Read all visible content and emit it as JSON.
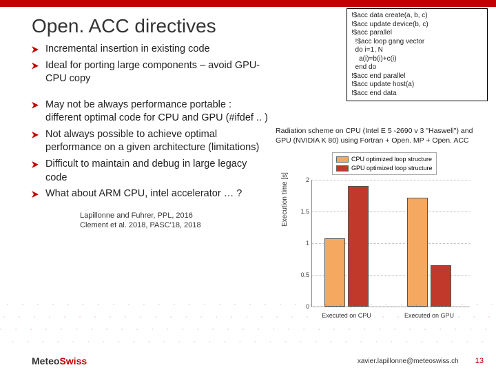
{
  "title": "Open. ACC directives",
  "pros": [
    "Incremental insertion in existing code",
    "Ideal for porting large components – avoid GPU-CPU copy"
  ],
  "cons": [
    "May not be always performance portable : different optimal code for CPU and GPU (#ifdef .. )",
    "Not always possible to achieve optimal performance on a given architecture (limitations)",
    "Difficult to maintain and debug in large legacy code",
    "What about ARM CPU, intel accelerator … ?"
  ],
  "refs": [
    "Lapillonne and Fuhrer, PPL, 2016",
    "Clement et al. 2018, PASC'18, 2018"
  ],
  "code_lines": "!$acc data create(a, b, c)\n!$acc update device(b, c)\n!$acc parallel\n  !$acc loop gang vector\n  do i=1, N\n    a(i)=b(i)+c(i)\n  end do\n!$acc end parallel\n!$acc update host(a)\n!$acc end data",
  "chart_caption": "Radiation scheme on CPU (Intel E 5 -2690 v 3 \"Haswell\") and GPU (NVIDIA K 80) using Fortran + Open. MP + Open. ACC",
  "chart_data": {
    "type": "bar",
    "title": "",
    "xlabel": "",
    "ylabel": "Execution time [s]",
    "ylim": [
      0,
      2.0
    ],
    "yticks": [
      0,
      0.5,
      1.0,
      1.5,
      2.0
    ],
    "categories": [
      "Executed on CPU",
      "Executed on GPU"
    ],
    "series": [
      {
        "name": "CPU optimized loop structure",
        "values": [
          1.08,
          1.72
        ]
      },
      {
        "name": "GPU optimized loop structure",
        "values": [
          1.9,
          0.65
        ]
      }
    ],
    "legend_position": "top"
  },
  "footer": {
    "logo_main": "Meteo",
    "logo_accent": "Swiss",
    "email": "xavier.lapillonne@meteoswiss.ch",
    "page": "13"
  }
}
